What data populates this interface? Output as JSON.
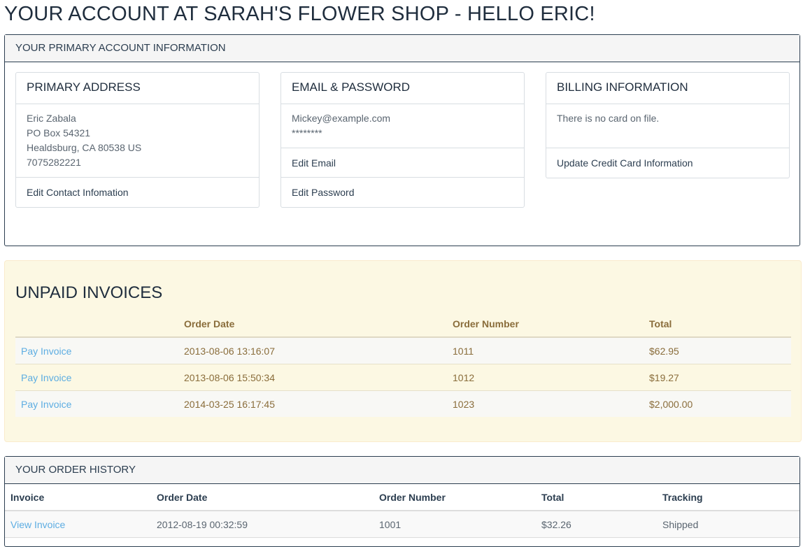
{
  "page": {
    "title": "YOUR ACCOUNT AT SARAH'S FLOWER SHOP - HELLO ERIC!"
  },
  "account_panel": {
    "heading": "YOUR PRIMARY ACCOUNT INFORMATION",
    "address_card": {
      "title": "PRIMARY ADDRESS",
      "lines": [
        "Eric Zabala",
        "PO Box 54321",
        "Healdsburg, CA 80538 US",
        "7075282221"
      ],
      "edit_link": "Edit Contact Infomation"
    },
    "email_card": {
      "title": "EMAIL & PASSWORD",
      "email": "Mickey@example.com",
      "password_mask": "********",
      "edit_email_link": "Edit Email",
      "edit_password_link": "Edit Password"
    },
    "billing_card": {
      "title": "BILLING INFORMATION",
      "status": "There is no card on file.",
      "update_link": "Update Credit Card Information"
    }
  },
  "unpaid_invoices": {
    "title": "UNPAID INVOICES",
    "columns": [
      "",
      "Order Date",
      "Order Number",
      "Total"
    ],
    "rows": [
      {
        "action": "Pay Invoice",
        "order_date": "2013-08-06 13:16:07",
        "order_number": "1011",
        "total": "$62.95"
      },
      {
        "action": "Pay Invoice",
        "order_date": "2013-08-06 15:50:34",
        "order_number": "1012",
        "total": "$19.27"
      },
      {
        "action": "Pay Invoice",
        "order_date": "2014-03-25 16:17:45",
        "order_number": "1023",
        "total": "$2,000.00"
      }
    ]
  },
  "order_history": {
    "heading": "YOUR ORDER HISTORY",
    "columns": [
      "Invoice",
      "Order Date",
      "Order Number",
      "Total",
      "Tracking"
    ],
    "rows": [
      {
        "action": "View Invoice",
        "order_date": "2012-08-19 00:32:59",
        "order_number": "1001",
        "total": "$32.26",
        "tracking": "Shipped"
      }
    ]
  },
  "colors": {
    "link": "#5dade2",
    "warning_bg": "#fcf8e3",
    "warning_text": "#8a6d3b",
    "panel_border": "#2c3e50"
  }
}
